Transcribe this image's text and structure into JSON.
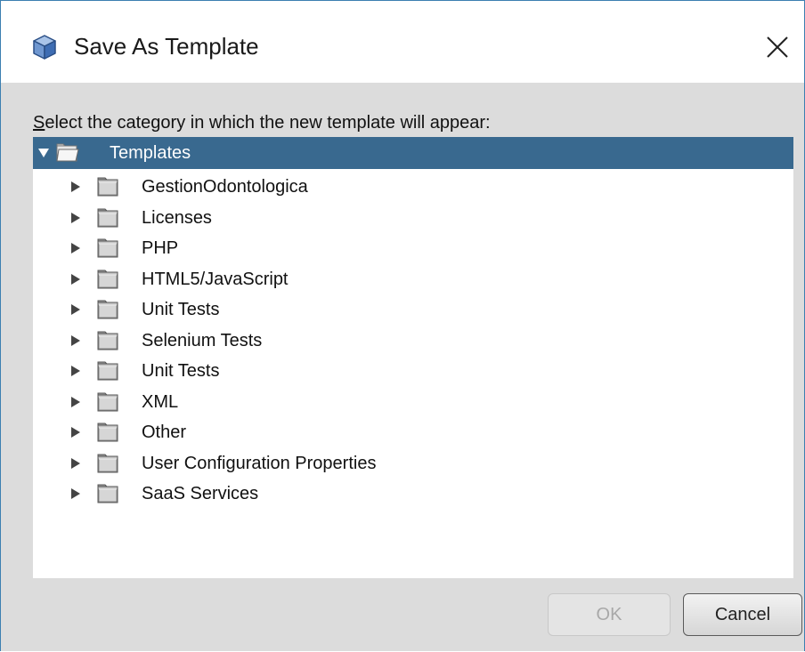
{
  "window": {
    "title": "Save As Template",
    "close_icon": "close-icon",
    "app_icon": "cube-icon"
  },
  "prompt": {
    "text": "Select the category in which the new template will appear:",
    "mnemonic": "S"
  },
  "tree": {
    "root": {
      "label": "Templates",
      "expanded": true,
      "selected": true,
      "icon": "open-folder-icon"
    },
    "children": [
      {
        "label": "GestionOdontologica",
        "expanded": false,
        "icon": "folder-icon"
      },
      {
        "label": "Licenses",
        "expanded": false,
        "icon": "folder-icon"
      },
      {
        "label": "PHP",
        "expanded": false,
        "icon": "folder-icon"
      },
      {
        "label": "HTML5/JavaScript",
        "expanded": false,
        "icon": "folder-icon"
      },
      {
        "label": "Unit Tests",
        "expanded": false,
        "icon": "folder-icon"
      },
      {
        "label": "Selenium Tests",
        "expanded": false,
        "icon": "folder-icon"
      },
      {
        "label": "Unit Tests",
        "expanded": false,
        "icon": "folder-icon"
      },
      {
        "label": "XML",
        "expanded": false,
        "icon": "folder-icon"
      },
      {
        "label": "Other",
        "expanded": false,
        "icon": "folder-icon"
      },
      {
        "label": "User Configuration Properties",
        "expanded": false,
        "icon": "folder-icon"
      },
      {
        "label": "SaaS Services",
        "expanded": false,
        "icon": "folder-icon"
      }
    ]
  },
  "buttons": {
    "ok_label": "OK",
    "ok_enabled": false,
    "cancel_label": "Cancel"
  },
  "colors": {
    "selection": "#39698f",
    "window_border": "#3c7fb1",
    "dialog_background": "#dcdcdc"
  }
}
